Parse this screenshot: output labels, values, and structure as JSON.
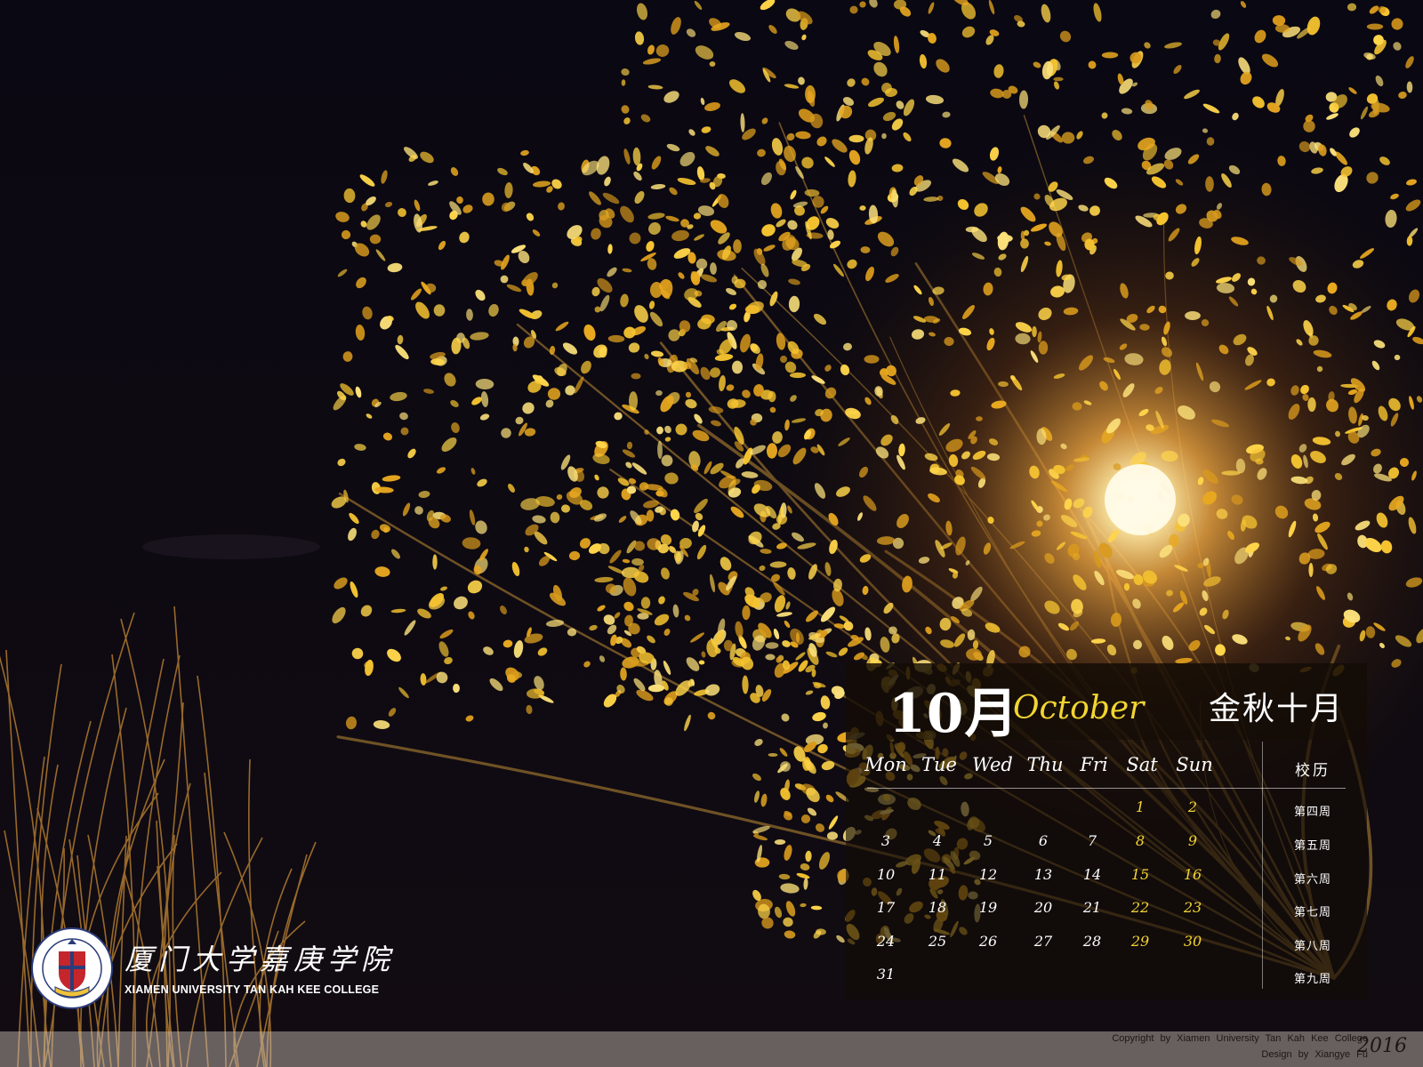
{
  "calendar": {
    "month_number": "10月",
    "month_en": "October",
    "month_cn": "金秋十月",
    "weekdays": [
      "Mon",
      "Tue",
      "Wed",
      "Thu",
      "Fri",
      "Sat",
      "Sun"
    ],
    "school_calendar_label": "校历",
    "weeks": [
      {
        "label": "第四周",
        "days": [
          "",
          "",
          "",
          "",
          "",
          "1",
          "2"
        ]
      },
      {
        "label": "第五周",
        "days": [
          "3",
          "4",
          "5",
          "6",
          "7",
          "8",
          "9"
        ]
      },
      {
        "label": "第六周",
        "days": [
          "10",
          "11",
          "12",
          "13",
          "14",
          "15",
          "16"
        ]
      },
      {
        "label": "第七周",
        "days": [
          "17",
          "18",
          "19",
          "20",
          "21",
          "22",
          "23"
        ]
      },
      {
        "label": "第八周",
        "days": [
          "24",
          "25",
          "26",
          "27",
          "28",
          "29",
          "30"
        ]
      },
      {
        "label": "第九周",
        "days": [
          "31",
          "",
          "",
          "",
          "",
          "",
          ""
        ]
      }
    ],
    "weekend_color": "#f3d531"
  },
  "logo": {
    "name_cn": "厦门大学嘉庚学院",
    "name_en": "XIAMEN UNIVERSITY TAN KAH KEE COLLEGE",
    "seal_year": "2003"
  },
  "footer": {
    "copyright": "Copyright by Xiamen University Tan Kah Kee College",
    "design": "Design by Xiangye Fu",
    "year": "2016"
  },
  "colors": {
    "sky": "#0b0912",
    "leaves": "#f2c030",
    "lamp": "#fff6d0"
  }
}
